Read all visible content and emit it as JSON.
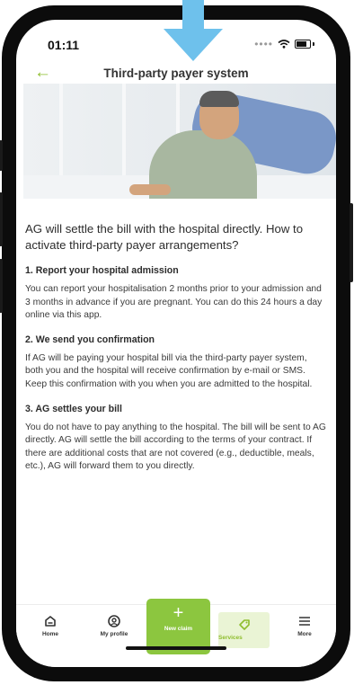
{
  "status_bar": {
    "time": "01:11"
  },
  "header": {
    "back_icon": "arrow-left-icon",
    "title": "Third-party payer system"
  },
  "hero": {
    "image": "hospital-patient-photo"
  },
  "content": {
    "intro": "AG will settle the bill with the hospital directly. How to activate third-party payer arrangements?",
    "sections": [
      {
        "title": "1. Report your hospital admission",
        "text": "You can report your hospitalisation 2 months prior to your admission and 3 months in advance if you are pregnant. You can do this 24 hours a day online via this app."
      },
      {
        "title": "2. We send you confirmation",
        "text": "If AG will be paying your hospital bill via the third-party payer system, both you and the hospital will receive confirmation by e-mail or SMS. Keep this confirmation with you when you are admitted to the hospital."
      },
      {
        "title": "3. AG settles your bill",
        "text": "You do not have to pay anything to the hospital. The bill will be sent to AG directly. AG will settle the bill according to the terms of your contract. If there are additional costs that are not covered (e.g., deductible, meals, etc.), AG will forward them to you directly."
      }
    ]
  },
  "tabbar": {
    "home": "Home",
    "profile": "My profile",
    "new_claim": "New claim",
    "services": "Services",
    "more": "More"
  },
  "colors": {
    "accent": "#8cc63f",
    "accent_light": "#eaf4d5",
    "arrow": "#6ec1ec"
  }
}
